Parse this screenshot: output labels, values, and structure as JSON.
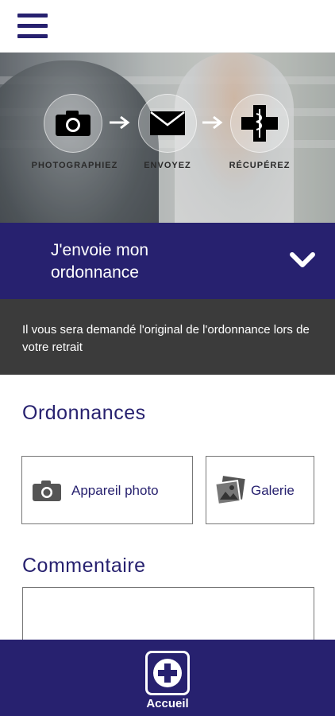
{
  "header": {
    "menu_icon": "hamburger-menu-icon"
  },
  "hero": {
    "steps": [
      {
        "label": "PHOTOGRAPHIEZ",
        "icon": "camera-icon"
      },
      {
        "label": "ENVOYEZ",
        "icon": "envelope-icon"
      },
      {
        "label": "RÉCUPÉREZ",
        "icon": "pharmacy-cross-icon"
      }
    ],
    "arrow_icon": "arrow-right-icon"
  },
  "banner": {
    "title": "J'envoie mon ordonnance",
    "chevron_icon": "chevron-down-icon"
  },
  "notice": {
    "text": "Il vous sera demandé l'original de l'ordonnance lors de votre retrait"
  },
  "prescriptions": {
    "title": "Ordonnances",
    "camera_button": {
      "label": "Appareil photo",
      "icon": "camera-icon"
    },
    "gallery_button": {
      "label": "Galerie",
      "icon": "gallery-icon"
    }
  },
  "comment": {
    "title": "Commentaire",
    "value": ""
  },
  "footer": {
    "home_label": "Accueil",
    "home_icon": "plus-circle-icon"
  },
  "colors": {
    "primary": "#27216f",
    "notice_bg": "#3b3b3b",
    "white": "#ffffff"
  }
}
